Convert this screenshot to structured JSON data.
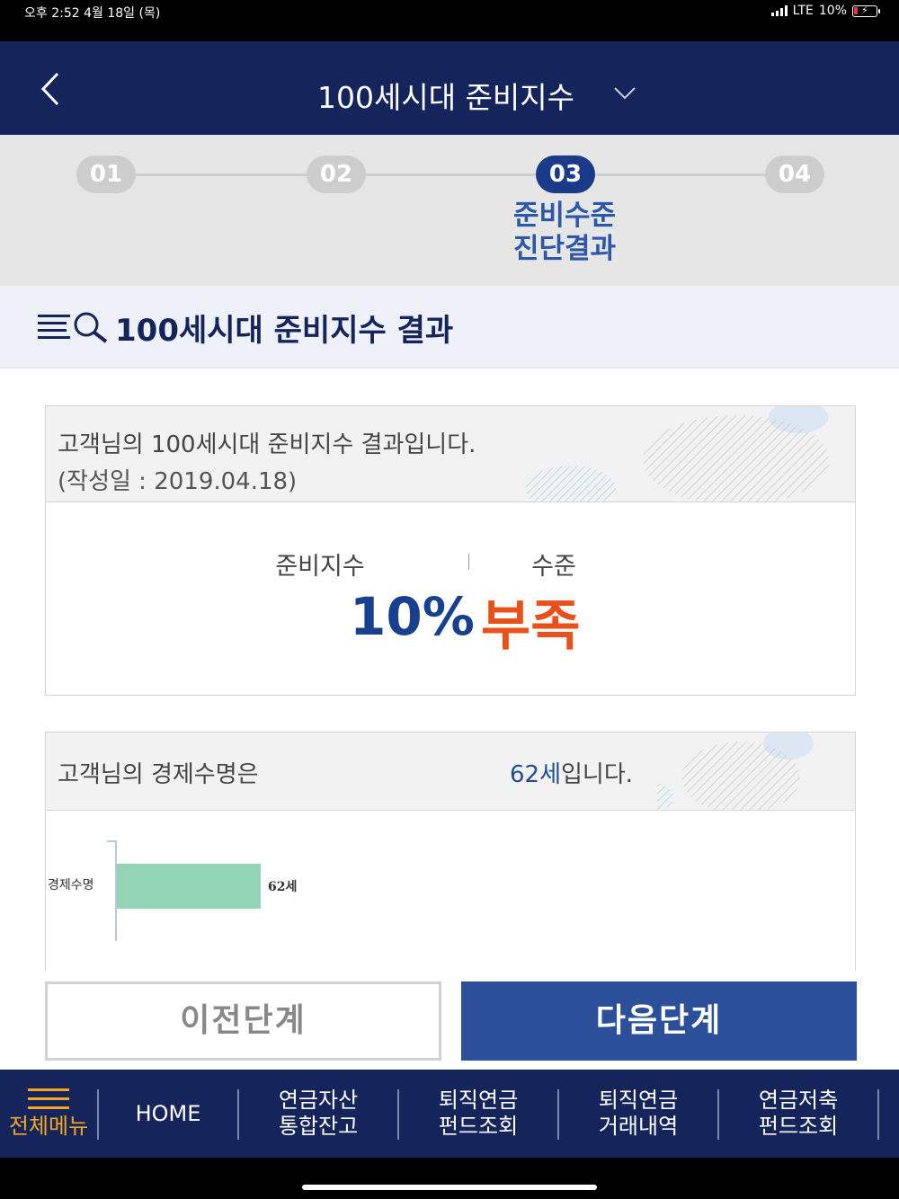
{
  "status_bar": {
    "time_date": "오후 2:52   4월 18일 (목)",
    "network": "LTE",
    "battery": "10%"
  },
  "header": {
    "title": "100세시대 준비지수",
    "back_icon": "chevron-left-icon",
    "dropdown_icon": "chevron-down-icon"
  },
  "steps": {
    "items": [
      {
        "number": "01",
        "active": false
      },
      {
        "number": "02",
        "active": false
      },
      {
        "number": "03",
        "active": true
      },
      {
        "number": "04",
        "active": false
      }
    ],
    "active_label_line1": "준비수준",
    "active_label_line2": "진단결과"
  },
  "section": {
    "icon": "search-list-icon",
    "title": "100세시대 준비지수 결과"
  },
  "result_card": {
    "message": "고객님의 100세시대 준비지수 결과입니다.",
    "date_text": "(작성일 : 2019.04.18)",
    "index_label": "준비지수",
    "level_label": "수준",
    "index_value": "10%",
    "level_value": "부족"
  },
  "life_card": {
    "message": "고객님의 경제수명은",
    "age_number": "62세",
    "age_suffix": "입니다."
  },
  "chart_data": {
    "type": "bar",
    "orientation": "horizontal",
    "categories": [
      "경제수명"
    ],
    "values": [
      62
    ],
    "value_labels": [
      "62세"
    ],
    "bar_color": "#93d3b6"
  },
  "buttons": {
    "prev": "이전단계",
    "next": "다음단계"
  },
  "bottom_nav": {
    "menu_label": "전체메뉴",
    "items": [
      {
        "line1": "HOME",
        "line2": ""
      },
      {
        "line1": "연금자산",
        "line2": "통합잔고"
      },
      {
        "line1": "퇴직연금",
        "line2": "펀드조회"
      },
      {
        "line1": "퇴직연금",
        "line2": "거래내역"
      },
      {
        "line1": "연금저축",
        "line2": "펀드조회"
      }
    ]
  },
  "colors": {
    "header_navy": "#15255c",
    "active_step": "#1b3a8a",
    "index_blue": "#17418f",
    "level_orange": "#e8511a",
    "next_button": "#2c4f99",
    "menu_accent": "#f5a623"
  }
}
